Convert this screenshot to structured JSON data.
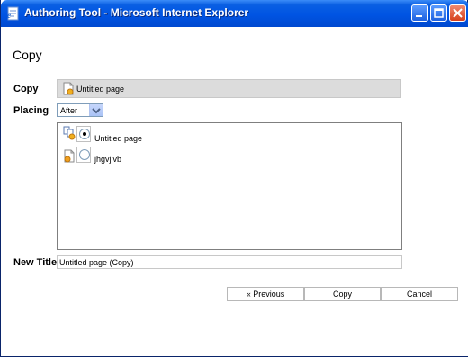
{
  "window": {
    "title": "Authoring Tool - Microsoft Internet Explorer",
    "controls": [
      "minimize",
      "maximize",
      "close"
    ]
  },
  "page": {
    "title": "Copy"
  },
  "form": {
    "copy_label": "Copy",
    "copy_value": "Untitled page",
    "placing_label": "Placing",
    "placing_value": "After",
    "pages": [
      {
        "label": "Untitled page",
        "selected": true,
        "icon": "folder-page-icon"
      },
      {
        "label": "jhgvjlvb",
        "selected": false,
        "icon": "page-icon"
      }
    ],
    "new_title_label": "New Title",
    "new_title_value": "Untitled page (Copy)"
  },
  "buttons": {
    "previous": "« Previous",
    "copy": "Copy",
    "cancel": "Cancel"
  },
  "colors": {
    "titlebar": "#0054e3",
    "close_button": "#d6401c"
  }
}
